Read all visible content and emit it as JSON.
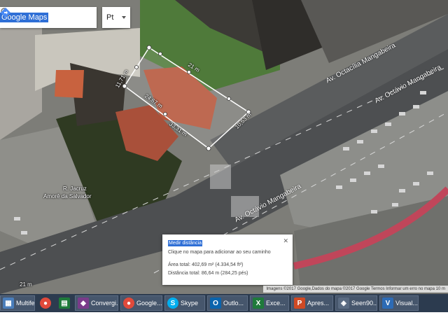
{
  "search": {
    "value": "Google Maps"
  },
  "language": {
    "selected": "Pt"
  },
  "icons": {
    "search": "search-icon",
    "directions": "directions-icon",
    "close": "close-icon"
  },
  "map_labels": {
    "street_1": "Av. Octacília Mangabeira",
    "street_2": "Av. Octávio Mangabeira",
    "street_3": "Av. Octávio Mangabeira",
    "place": "R. Jacruz",
    "place_2": "Amorê da Salvador",
    "edge_top_1": "24,67 m",
    "edge_top_2": "21 m",
    "edge_left": "11,71 m",
    "edge_right": "10,53 m",
    "edge_bottom": "33,31 m",
    "small_left": "21 m"
  },
  "popup": {
    "title": "Medir distância",
    "hint": "Clique no mapa para adicionar ao seu caminho",
    "area": "Área total: 402,69 m² (4.334,54 ft²)",
    "distance": "Distância total: 86,64 m (284,25 pés)"
  },
  "attribution": "Imagens ©2017 Google,Dados do mapa ©2017 Google   Termos   Informar um erro no mapa   10 m",
  "taskbar": {
    "items": [
      {
        "label": "Multife...",
        "icon": "windows-icon",
        "color": "#4a7ebb"
      },
      {
        "label": "",
        "icon": "chrome-icon",
        "color": "#e04a3b"
      },
      {
        "label": "",
        "icon": "excel-grid-icon",
        "color": "#1f7a3b"
      },
      {
        "label": "Convergi...",
        "icon": "app-icon",
        "color": "#7a3b8a"
      },
      {
        "label": "Google...",
        "icon": "chrome-icon",
        "color": "#e04a3b"
      },
      {
        "label": "Skype",
        "icon": "skype-icon",
        "color": "#00aff0"
      },
      {
        "label": "Outlo...",
        "icon": "outlook-icon",
        "color": "#0a64ad"
      },
      {
        "label": "Exce...",
        "icon": "excel-icon",
        "color": "#1f7a3b"
      },
      {
        "label": "Apres...",
        "icon": "powerpoint-icon",
        "color": "#d04a24"
      },
      {
        "label": "Seen90...",
        "icon": "app-icon",
        "color": "#5a6b82"
      },
      {
        "label": "Visual...",
        "icon": "visual-icon",
        "color": "#2d6bb5"
      }
    ]
  }
}
